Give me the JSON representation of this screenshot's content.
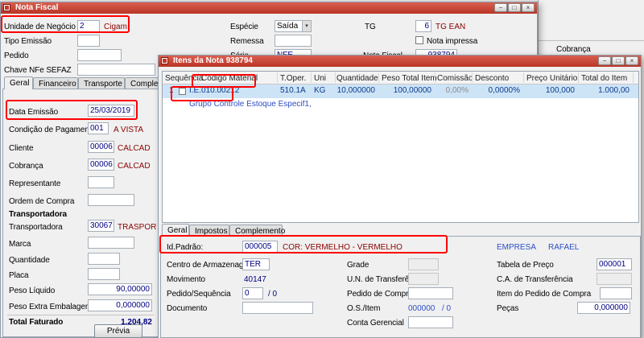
{
  "colors": {
    "titlebar_red": "#C0392B",
    "annotation_red": "#FF0000",
    "field_value_navy": "#000080",
    "description_maroon": "#8B0000",
    "link_blue": "#2E4FC5",
    "selected_row_blue": "#CDE4F7"
  },
  "icons": {
    "minimize": "−",
    "maximize": "□",
    "close": "×",
    "dropdown_arrow": "▾"
  },
  "nota_fiscal": {
    "title": "Nota Fiscal",
    "header_fields": {
      "unidade_negocio_label": "Unidade de Negócio",
      "unidade_negocio_value": "2",
      "unidade_negocio_desc": "Cigam",
      "tipo_emissao_label": "Tipo Emissão",
      "tipo_emissao_value": "",
      "pedido_label": "Pedido",
      "pedido_value": "",
      "chave_label": "Chave NFe SEFAZ",
      "chave_value": "",
      "especie_label": "Espécie",
      "especie_value": "Saída",
      "remessa_label": "Remessa",
      "remessa_value": "",
      "serie_label": "Série",
      "serie_value": "NFE",
      "tg_label": "TG",
      "tg_value": "6",
      "tg_desc": "TG EAN",
      "nota_impressa_label": "Nota impressa",
      "nota_fiscal_label": "Nota Fiscal",
      "nota_fiscal_value": "938794"
    },
    "tabs": {
      "geral": "Geral",
      "financeiro": "Financeiro",
      "transporte": "Transporte",
      "complemento": "Complemento"
    },
    "geral": {
      "data_emissao_label": "Data Emissão",
      "data_emissao_value": "25/03/2019",
      "condicao_label": "Condição de Pagamento",
      "condicao_code": "001",
      "condicao_desc": "A VISTA",
      "cliente_label": "Cliente",
      "cliente_code": "00006",
      "cliente_desc": "CALCAD",
      "cobranca_label": "Cobrança",
      "cobranca_code": "00006",
      "cobranca_desc": "CALCAD",
      "representante_label": "Representante",
      "representante_code": "",
      "ordem_compra_label": "Ordem de Compra",
      "ordem_compra_value": "",
      "transportadora_section": "Transportadora",
      "transportadora_label": "Transportadora",
      "transportadora_code": "30067",
      "transportadora_desc": "TRASPOR",
      "marca_label": "Marca",
      "marca_value": "",
      "quantidade_label": "Quantidade",
      "quantidade_value": "",
      "placa_label": "Placa",
      "placa_value": "",
      "peso_liquido_label": "Peso Líquido",
      "peso_liquido_value": "90,00000",
      "peso_extra_label": "Peso Extra Embalagem",
      "peso_extra_value": "0,000000",
      "total_faturado_label": "Total Faturado",
      "total_faturado_value": "1.204,82",
      "previa_button": "Prévia"
    }
  },
  "background_panel": {
    "cobranca_label": "Cobrança"
  },
  "itens_nota": {
    "title": "Itens da Nota 938794",
    "grid": {
      "col_sequencia": "Sequência",
      "col_codigo": "Código Material",
      "col_toper": "T.Oper.",
      "col_uni": "Uni",
      "col_quantidade": "Quantidade",
      "col_peso": "Peso Total Item",
      "col_comissao": "Comissão",
      "col_desconto": "Desconto",
      "col_preco": "Preço Unitário",
      "col_total": "Total do Item",
      "row1": {
        "sequencia": "1",
        "codigo": "I.E.010.00212",
        "toper": "510.1A",
        "uni": "KG",
        "quantidade": "10,000000",
        "peso": "100,00000",
        "comissao": "0,00%",
        "desconto": "0,0000%",
        "preco": "100,000",
        "total": "1.000,00"
      },
      "row1_detail": "Grupo Controle Estoque Especif1,"
    },
    "tabs": {
      "geral": "Geral",
      "impostos": "Impostos",
      "complemento": "Complemento"
    },
    "geral": {
      "id_padrao_label": "Id.Padrão:",
      "id_padrao_value": "000005",
      "id_padrao_desc": "COR: VERMELHO - VERMELHO",
      "empresa_label": "EMPRESA",
      "empresa_value": "RAFAEL",
      "centro_label": "Centro de Armazenagem",
      "centro_value": "TER",
      "grade_label": "Grade",
      "grade_value": "",
      "tabela_preco_label": "Tabela de Preço",
      "tabela_preco_value": "000001",
      "movimento_label": "Movimento",
      "movimento_value": "40147",
      "un_transf_label": "U.N. de Transferência",
      "un_transf_value": "",
      "ca_transf_label": "C.A. de Transferência",
      "ca_transf_value": "",
      "pedido_seq_label": "Pedido/Sequência",
      "pedido_seq_value": "0",
      "pedido_seq_suffix": "/ 0",
      "pedido_compra_label": "Pedido de Compra",
      "pedido_compra_value": "",
      "item_pedido_label": "Item do Pedido de Compra",
      "item_pedido_value": "",
      "documento_label": "Documento",
      "documento_value": "",
      "os_item_label": "O.S./Item",
      "os_item_value": "000000",
      "os_item_suffix": "/ 0",
      "pecas_label": "Peças",
      "pecas_value": "0,000000",
      "conta_gerencial_label": "Conta Gerencial",
      "conta_gerencial_value": ""
    }
  }
}
